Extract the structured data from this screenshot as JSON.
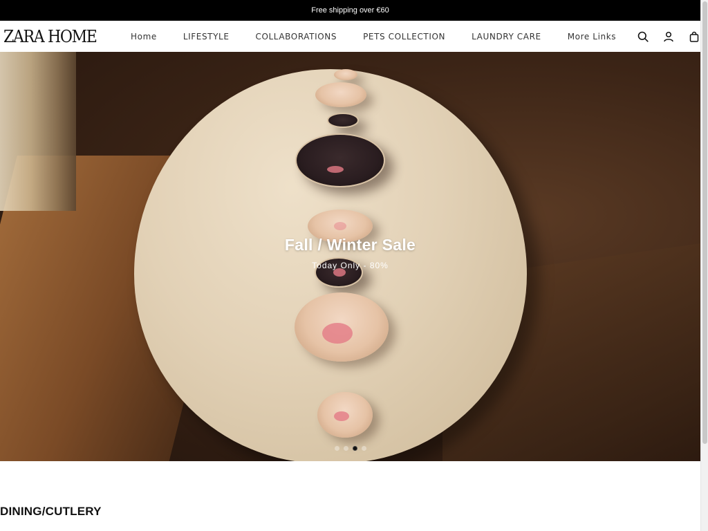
{
  "announcement": {
    "text": "Free shipping over €60"
  },
  "header": {
    "logo_text": "ZARA HOME",
    "nav": [
      {
        "label": "Home"
      },
      {
        "label": "LIFESTYLE"
      },
      {
        "label": "COLLABORATIONS"
      },
      {
        "label": "PETS COLLECTION"
      },
      {
        "label": "LAUNDRY CARE"
      },
      {
        "label": "More Links"
      }
    ],
    "icons": [
      "search-icon",
      "account-icon",
      "cart-icon"
    ]
  },
  "hero": {
    "title": "Fall / Winter Sale",
    "subtitle": "Today Only - 80%",
    "slides_total": 4,
    "active_slide": 3
  },
  "sections": {
    "dining_title": "DINING/CUTLERY"
  },
  "colors": {
    "announcement_bg": "#000000",
    "text": "#111111",
    "nav_text": "#333333"
  }
}
